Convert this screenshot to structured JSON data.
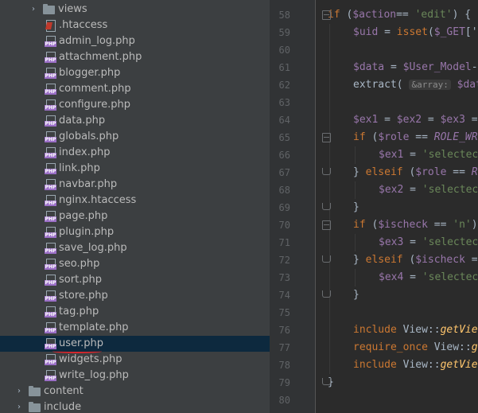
{
  "tree": {
    "items": [
      {
        "kind": "folder",
        "label": "views",
        "expand": "›"
      },
      {
        "kind": "hta",
        "label": ".htaccess"
      },
      {
        "kind": "php",
        "label": "admin_log.php"
      },
      {
        "kind": "php",
        "label": "attachment.php"
      },
      {
        "kind": "php",
        "label": "blogger.php"
      },
      {
        "kind": "php",
        "label": "comment.php"
      },
      {
        "kind": "php",
        "label": "configure.php"
      },
      {
        "kind": "php",
        "label": "data.php"
      },
      {
        "kind": "php",
        "label": "globals.php"
      },
      {
        "kind": "php",
        "label": "index.php"
      },
      {
        "kind": "php",
        "label": "link.php"
      },
      {
        "kind": "php",
        "label": "navbar.php"
      },
      {
        "kind": "file",
        "label": "nginx.htaccess"
      },
      {
        "kind": "php",
        "label": "page.php"
      },
      {
        "kind": "php",
        "label": "plugin.php"
      },
      {
        "kind": "php",
        "label": "save_log.php"
      },
      {
        "kind": "php",
        "label": "seo.php"
      },
      {
        "kind": "php",
        "label": "sort.php"
      },
      {
        "kind": "php",
        "label": "store.php"
      },
      {
        "kind": "php",
        "label": "tag.php"
      },
      {
        "kind": "php",
        "label": "template.php"
      },
      {
        "kind": "php",
        "label": "user.php",
        "selected": true
      },
      {
        "kind": "php",
        "label": "widgets.php"
      },
      {
        "kind": "php",
        "label": "write_log.php"
      },
      {
        "kind": "folder",
        "label": "content",
        "expand": "›"
      },
      {
        "kind": "folder",
        "label": "include",
        "expand": "›"
      }
    ],
    "php_badge": "PHP",
    "selected_color": "#0d293e",
    "annotation_color": "#d9262c"
  },
  "editor": {
    "line_numbers": [
      "58",
      "59",
      "60",
      "61",
      "62",
      "63",
      "64",
      "65",
      "66",
      "67",
      "68",
      "69",
      "70",
      "71",
      "72",
      "73",
      "74",
      "75",
      "76",
      "77",
      "78",
      "79",
      "80"
    ],
    "inlay_hint": "&array:",
    "colors": {
      "keyword": "#cc7832",
      "variable": "#9876aa",
      "string": "#6a8759",
      "function": "#ffc66d",
      "text": "#a9b7c6"
    }
  }
}
